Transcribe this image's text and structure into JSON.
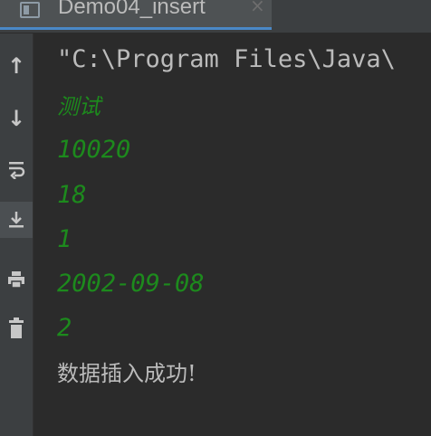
{
  "tab": {
    "title": "Demo04_insert",
    "close_glyph": "×",
    "icon": "java-class-icon"
  },
  "toolbar": {
    "items": [
      {
        "name": "up-arrow-icon",
        "glyph": "↑"
      },
      {
        "name": "down-arrow-icon",
        "glyph": "↓"
      },
      {
        "name": "soft-wrap-icon"
      },
      {
        "name": "scroll-to-end-icon"
      },
      {
        "name": "print-icon"
      },
      {
        "name": "trash-icon"
      }
    ]
  },
  "console": {
    "command": "\"C:\\Program Files\\Java\\",
    "inputs": [
      "测试",
      "10020",
      "18",
      "1",
      "2002-09-08",
      "2"
    ],
    "result": "数据插入成功!"
  },
  "colors": {
    "background": "#2b2b2b",
    "toolbar": "#3c3f41",
    "user_input": "#1d8a1d",
    "output_text": "#bbbbbb",
    "tab_underline": "#4a88c7"
  }
}
